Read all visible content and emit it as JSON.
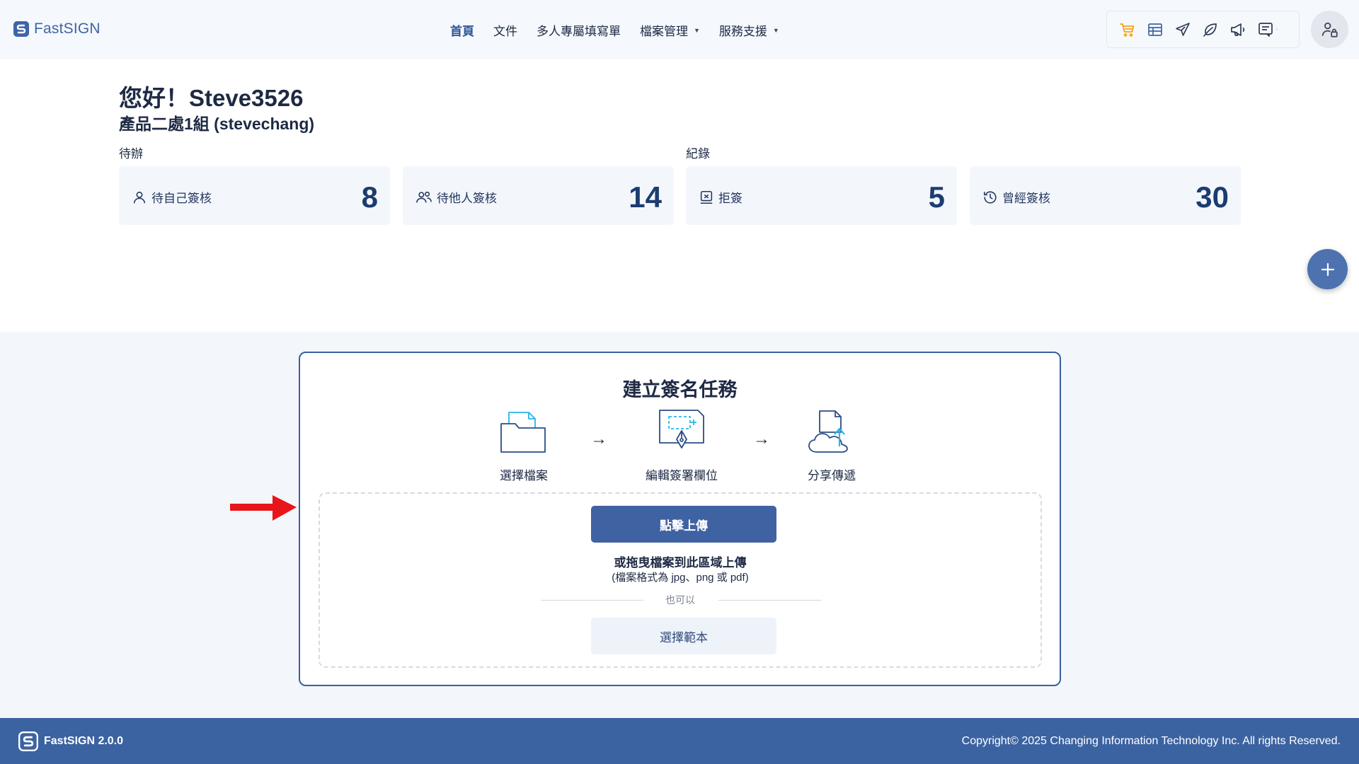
{
  "header": {
    "logo_text": "FastSIGN",
    "nav": [
      {
        "label": "首頁",
        "active": true
      },
      {
        "label": "文件"
      },
      {
        "label": "多人專屬填寫單"
      },
      {
        "label": "檔案管理",
        "dropdown": true
      },
      {
        "label": "服務支援",
        "dropdown": true
      }
    ],
    "toolbar_icons": [
      "cart-icon",
      "table-icon",
      "send-icon",
      "leaf-icon",
      "megaphone-icon",
      "notes-icon"
    ],
    "accent_color": "#f5a11c"
  },
  "greeting": {
    "hello": "您好！Steve3526",
    "department": "產品二處1組 (stevechang)"
  },
  "sections": {
    "todo": "待辦",
    "records": "紀錄"
  },
  "stats": [
    {
      "label": "待自己簽核",
      "count": "8",
      "icon": "user-icon"
    },
    {
      "label": "待他人簽核",
      "count": "14",
      "icon": "users-icon"
    },
    {
      "label": "拒簽",
      "count": "5",
      "icon": "stamp-icon"
    },
    {
      "label": "曾經簽核",
      "count": "30",
      "icon": "history-icon"
    }
  ],
  "create": {
    "title": "建立簽名任務",
    "steps": [
      "選擇檔案",
      "編輯簽署欄位",
      "分享傳遞"
    ],
    "arrow": "→",
    "upload_label": "點擊上傳",
    "drag_text": "或拖曳檔案到此區域上傳",
    "format_text": "(檔案格式為 jpg、png 或 pdf)",
    "or_text": "也可以",
    "template_label": "選擇範本"
  },
  "footer": {
    "brand": "FastSIGN 2.0.0",
    "copyright": "Copyright© 2025 Changing Information Technology Inc. All rights Reserved."
  },
  "colors": {
    "primary": "#3f62a2",
    "footer": "#3c63a1",
    "stat_count": "#1c3c70",
    "arrow_annotation": "#e8151b"
  }
}
